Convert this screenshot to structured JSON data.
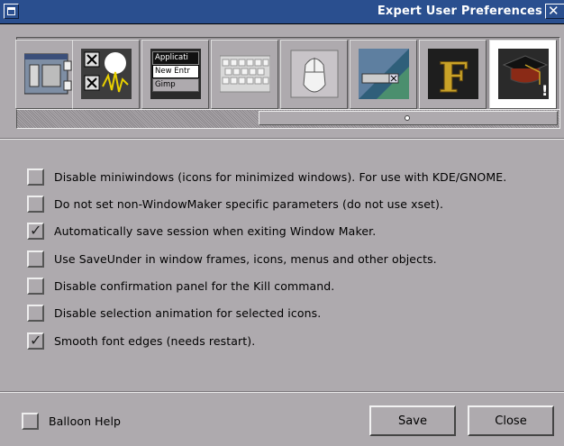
{
  "window": {
    "title": "Expert User Preferences",
    "minimize_icon": "miniaturize-icon",
    "close_glyph": "✕"
  },
  "panel_icons": [
    {
      "name": "window-handling-icon"
    },
    {
      "name": "window-focus-icon"
    },
    {
      "name": "menu-preferences-icon",
      "lines": [
        "Applicati",
        "New Entr",
        "Gimp"
      ]
    },
    {
      "name": "keyboard-icon"
    },
    {
      "name": "mouse-icon"
    },
    {
      "name": "workspace-icon"
    },
    {
      "name": "font-icon",
      "letter": "F"
    },
    {
      "name": "expert-user-icon",
      "mark": "!"
    }
  ],
  "options": [
    {
      "label": "Disable miniwindows (icons for minimized windows). For use with KDE/GNOME.",
      "checked": false
    },
    {
      "label": "Do not set non-WindowMaker specific parameters (do not use xset).",
      "checked": false
    },
    {
      "label": "Automatically save session when exiting Window Maker.",
      "checked": true
    },
    {
      "label": "Use SaveUnder in window frames, icons, menus and other objects.",
      "checked": false
    },
    {
      "label": "Disable confirmation panel for the Kill command.",
      "checked": false
    },
    {
      "label": "Disable selection animation for selected icons.",
      "checked": false
    },
    {
      "label": "Smooth font edges (needs restart).",
      "checked": true
    }
  ],
  "footer": {
    "balloon_help_label": "Balloon Help",
    "balloon_help_checked": false,
    "save_label": "Save",
    "close_label": "Close"
  },
  "colors": {
    "titlebar": "#2a4f8f",
    "background": "#aeaaae",
    "selected_panel": "#ffffff"
  }
}
